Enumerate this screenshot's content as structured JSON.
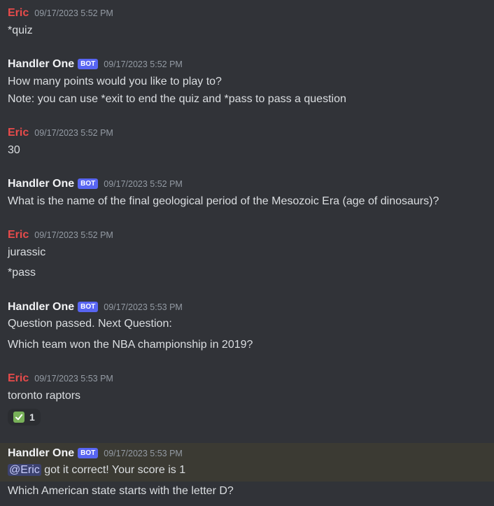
{
  "bot_tag": "BOT",
  "messages": [
    {
      "author": "Eric",
      "time": "09/17/2023 5:52 PM",
      "lines": [
        "*quiz"
      ]
    },
    {
      "author": "Handler One",
      "time": "09/17/2023 5:52 PM",
      "lines": [
        "How many points would you like to play to?",
        "Note: you can use *exit to end the quiz and *pass to pass a question"
      ]
    },
    {
      "author": "Eric",
      "time": "09/17/2023 5:52 PM",
      "lines": [
        "30"
      ]
    },
    {
      "author": "Handler One",
      "time": "09/17/2023 5:52 PM",
      "lines": [
        "What is the name of the final geological period of the Mesozoic Era (age of dinosaurs)?"
      ]
    },
    {
      "author": "Eric",
      "time": "09/17/2023 5:52 PM",
      "lines": [
        "jurassic",
        "*pass"
      ]
    },
    {
      "author": "Handler One",
      "time": "09/17/2023 5:53 PM",
      "lines": [
        "Question passed. Next Question:",
        "Which team won the NBA championship in 2019?"
      ]
    },
    {
      "author": "Eric",
      "time": "09/17/2023 5:53 PM",
      "lines": [
        "toronto raptors"
      ],
      "reaction": {
        "icon": "check-mark-icon",
        "count": "1"
      }
    },
    {
      "author": "Handler One",
      "time": "09/17/2023 5:53 PM",
      "mention": "@Eric",
      "lines": [
        " got it correct! Your score is 1",
        "Which American state starts with the letter D?"
      ]
    }
  ]
}
